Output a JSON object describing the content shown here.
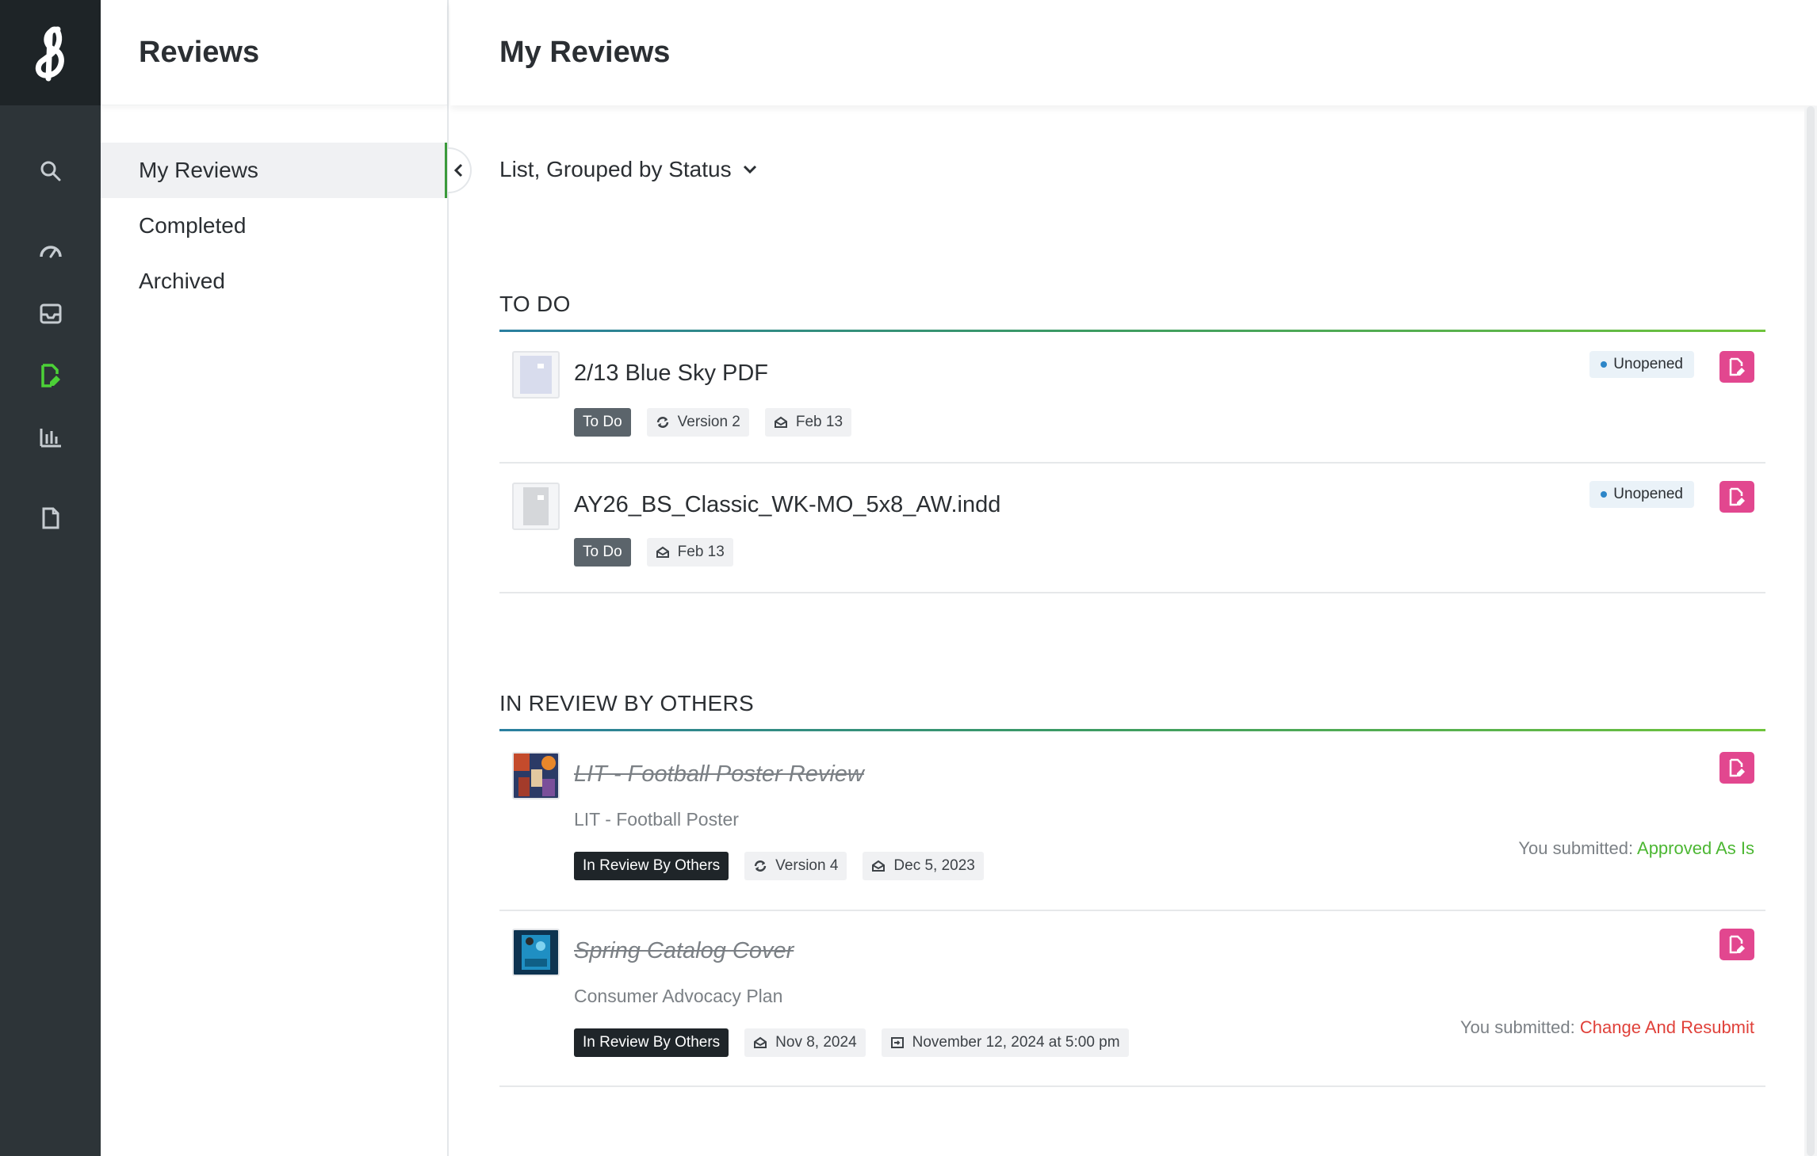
{
  "app": {
    "section_title": "Reviews",
    "page_title": "My Reviews"
  },
  "rail": {
    "icons": [
      "logo-icon",
      "search-icon",
      "dashboard-icon",
      "inbox-icon",
      "reviews-icon",
      "reports-icon",
      "document-icon"
    ],
    "active": "reviews-icon",
    "accent": "#4cd137"
  },
  "subnav": {
    "items": [
      {
        "label": "My Reviews",
        "active": true
      },
      {
        "label": "Completed",
        "active": false
      },
      {
        "label": "Archived",
        "active": false
      }
    ]
  },
  "view": {
    "selected": "List, Grouped by Status"
  },
  "sections": {
    "todo": {
      "title": "TO DO",
      "rows": [
        {
          "title": "2/13 Blue Sky PDF",
          "status_tag": "To Do",
          "version": "Version 2",
          "date": "Feb 13",
          "open_status": "Unopened"
        },
        {
          "title": "AY26_BS_Classic_WK-MO_5x8_AW.indd",
          "status_tag": "To Do",
          "date": "Feb 13",
          "open_status": "Unopened"
        }
      ]
    },
    "in_review": {
      "title": "IN REVIEW BY OTHERS",
      "rows": [
        {
          "title": "LIT - Football Poster Review",
          "subtitle": "LIT - Football Poster",
          "status_tag": "In Review By Others",
          "version": "Version 4",
          "date": "Dec 5, 2023",
          "submitted_label": "You submitted:",
          "submitted_value": "Approved As Is"
        },
        {
          "title": "Spring Catalog Cover",
          "subtitle": "Consumer Advocacy Plan",
          "status_tag": "In Review By Others",
          "date": "Nov 8, 2024",
          "due": "November 12, 2024 at 5:00 pm",
          "submitted_label": "You submitted:",
          "submitted_value": "Change And Resubmit"
        }
      ]
    }
  },
  "colors": {
    "rail_bg": "#2d3438",
    "action_pink": "#e2478f",
    "approved_green": "#4cb733",
    "change_red": "#e0413a"
  }
}
